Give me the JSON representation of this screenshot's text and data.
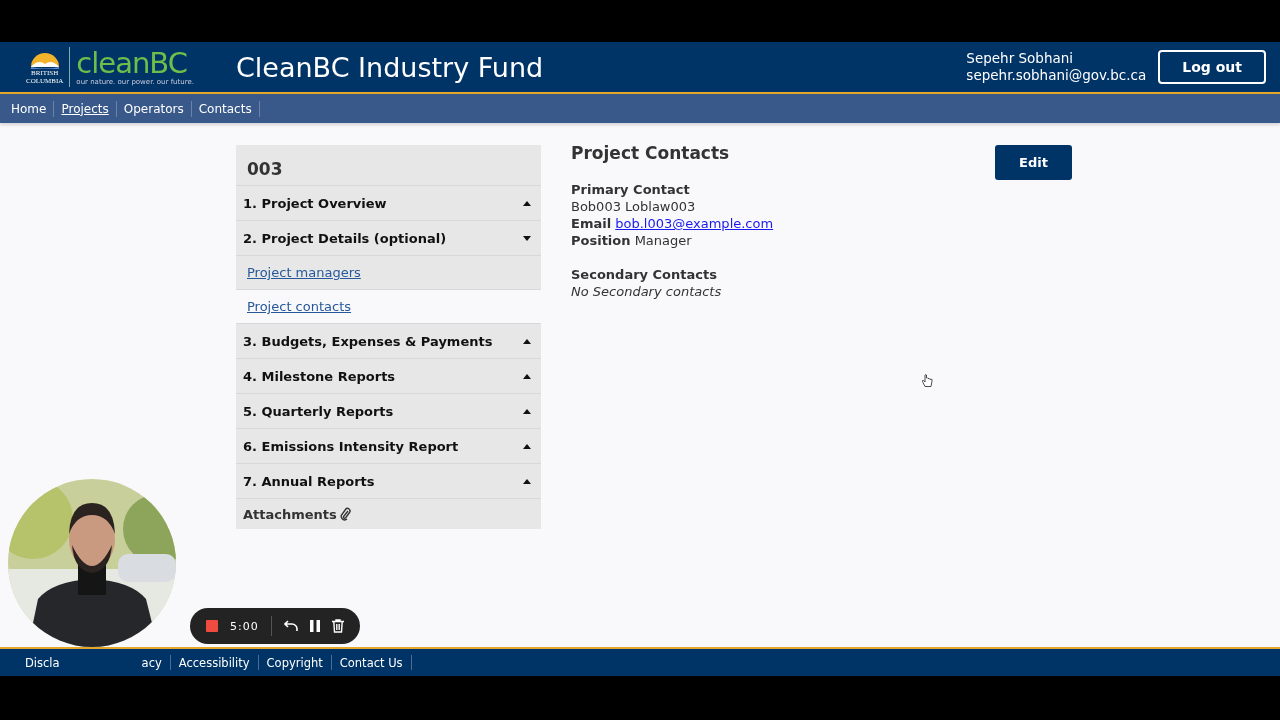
{
  "header": {
    "logo": {
      "province_line_1": "BRITISH",
      "province_line_2": "COLUMBIA",
      "brand": "cleanBC",
      "tagline": "our nature. our power. our future."
    },
    "title": "CleanBC Industry Fund",
    "user": {
      "name": "Sepehr Sobhani",
      "email": "sepehr.sobhani@gov.bc.ca"
    },
    "logout_button": "Log out"
  },
  "nav": [
    {
      "label": "Home",
      "selected": false
    },
    {
      "label": "Projects",
      "selected": true
    },
    {
      "label": "Operators",
      "selected": false
    },
    {
      "label": "Contacts",
      "selected": false
    }
  ],
  "sidebar": {
    "title": "003",
    "sections": [
      {
        "label": "1. Project Overview",
        "expanded": false
      },
      {
        "label": "2. Project Details (optional)",
        "expanded": true,
        "children": [
          {
            "label": "Project managers",
            "selected": false
          },
          {
            "label": "Project contacts",
            "selected": true
          }
        ]
      },
      {
        "label": "3. Budgets, Expenses & Payments",
        "expanded": false
      },
      {
        "label": "4. Milestone Reports",
        "expanded": false
      },
      {
        "label": "5. Quarterly Reports",
        "expanded": false
      },
      {
        "label": "6. Emissions Intensity Report",
        "expanded": false
      },
      {
        "label": "7. Annual Reports",
        "expanded": false
      }
    ],
    "attachments": "Attachments"
  },
  "content": {
    "title": "Project Contacts",
    "edit_button": "Edit",
    "primary": {
      "heading": "Primary Contact",
      "name": "Bob003 Loblaw003",
      "email_label": "Email",
      "email": "bob.l003@example.com",
      "position_label": "Position",
      "position": "Manager"
    },
    "secondary": {
      "heading": "Secondary Contacts",
      "empty": "No Secondary contacts"
    }
  },
  "footer": [
    "Discla",
    "acy",
    "Accessibility",
    "Copyright",
    "Contact Us"
  ],
  "recorder": {
    "time": "5:00"
  }
}
